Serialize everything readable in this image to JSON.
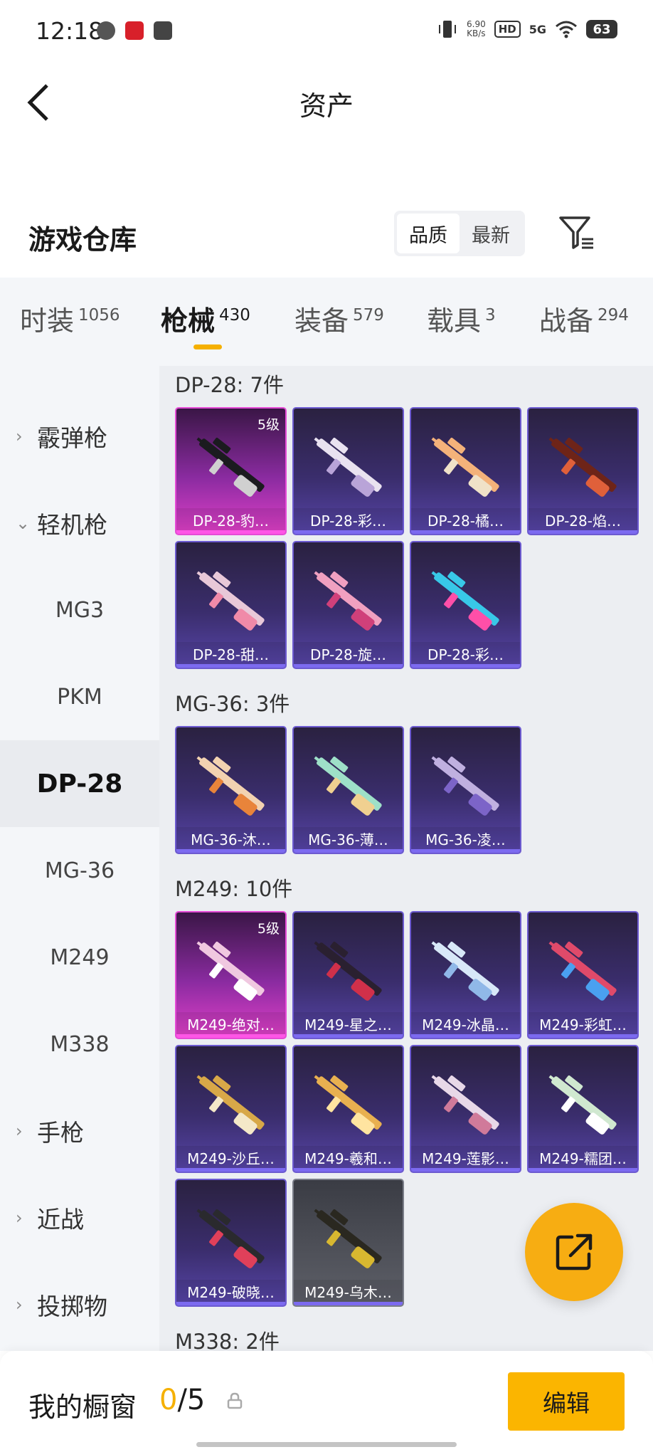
{
  "status_bar": {
    "time": "12:18",
    "net_speed": "6.90",
    "net_unit": "KB/s",
    "hd": "HD",
    "signal": "5G",
    "battery": "63"
  },
  "header": {
    "title": "资产"
  },
  "warehouse": {
    "title": "游戏仓库",
    "sort_options": [
      "品质",
      "最新"
    ]
  },
  "tabs": [
    {
      "label": "时装",
      "count": "1056"
    },
    {
      "label": "枪械",
      "count": "430"
    },
    {
      "label": "装备",
      "count": "579"
    },
    {
      "label": "载具",
      "count": "3"
    },
    {
      "label": "战备",
      "count": "294"
    }
  ],
  "sidebar": {
    "items": [
      {
        "label": "霰弹枪",
        "type": "group",
        "expanded": false
      },
      {
        "label": "轻机枪",
        "type": "group",
        "expanded": true
      },
      {
        "label": "MG3",
        "type": "sub"
      },
      {
        "label": "PKM",
        "type": "sub"
      },
      {
        "label": "DP-28",
        "type": "sub",
        "selected": true
      },
      {
        "label": "MG-36",
        "type": "sub"
      },
      {
        "label": "M249",
        "type": "sub"
      },
      {
        "label": "M338",
        "type": "sub"
      },
      {
        "label": "手枪",
        "type": "group",
        "expanded": false
      },
      {
        "label": "近战",
        "type": "group",
        "expanded": false
      },
      {
        "label": "投掷物",
        "type": "group",
        "expanded": false
      }
    ]
  },
  "sections": [
    {
      "title": "DP-28: 7件",
      "items": [
        {
          "label": "DP-28-豹…",
          "level": "5级",
          "rarity": "pink",
          "gun_color": "#1b1b1f",
          "accent": "#d0d0d0"
        },
        {
          "label": "DP-28-彩…",
          "rarity": "purple",
          "gun_color": "#e9e2f0",
          "accent": "#b9a4d8"
        },
        {
          "label": "DP-28-橘…",
          "rarity": "purple",
          "gun_color": "#f4b27a",
          "accent": "#f0e2c8"
        },
        {
          "label": "DP-28-焰…",
          "rarity": "purple",
          "gun_color": "#6e2418",
          "accent": "#e0603a"
        },
        {
          "label": "DP-28-甜…",
          "rarity": "purple",
          "gun_color": "#e8c8d8",
          "accent": "#f08aa8"
        },
        {
          "label": "DP-28-旋…",
          "rarity": "purple",
          "gun_color": "#f0a0c0",
          "accent": "#d0407a"
        },
        {
          "label": "DP-28-彩…",
          "rarity": "purple",
          "gun_color": "#38c8e8",
          "accent": "#ff4fa8"
        }
      ]
    },
    {
      "title": "MG-36: 3件",
      "items": [
        {
          "label": "MG-36-沐…",
          "rarity": "purple",
          "gun_color": "#f2d2b0",
          "accent": "#e8843a"
        },
        {
          "label": "MG-36-薄…",
          "rarity": "purple",
          "gun_color": "#9ee0c8",
          "accent": "#f0d090"
        },
        {
          "label": "MG-36-凌…",
          "rarity": "purple",
          "gun_color": "#c0b0e0",
          "accent": "#7c64c8"
        }
      ]
    },
    {
      "title": "M249: 10件",
      "items": [
        {
          "label": "M249-绝对…",
          "level": "5级",
          "rarity": "pink",
          "gun_color": "#f0c8e0",
          "accent": "#ffffff"
        },
        {
          "label": "M249-星之…",
          "rarity": "purple",
          "gun_color": "#2a2030",
          "accent": "#d0304a"
        },
        {
          "label": "M249-冰晶…",
          "rarity": "purple",
          "gun_color": "#d8e8f8",
          "accent": "#90b8e8"
        },
        {
          "label": "M249-彩虹…",
          "rarity": "purple",
          "gun_color": "#e04a6a",
          "accent": "#4aa0f0"
        },
        {
          "label": "M249-沙丘…",
          "rarity": "purple",
          "gun_color": "#d8a848",
          "accent": "#f4e8c8"
        },
        {
          "label": "M249-羲和…",
          "rarity": "purple",
          "gun_color": "#e8b050",
          "accent": "#ffe4a0"
        },
        {
          "label": "M249-莲影…",
          "rarity": "purple",
          "gun_color": "#e8d8e8",
          "accent": "#d07a9a"
        },
        {
          "label": "M249-糯团…",
          "rarity": "purple",
          "gun_color": "#d0e8d0",
          "accent": "#ffffff"
        },
        {
          "label": "M249-破晓…",
          "rarity": "purple",
          "gun_color": "#2a2a2e",
          "accent": "#e0405a"
        },
        {
          "label": "M249-乌木…",
          "rarity": "gray",
          "gun_color": "#2a2820",
          "accent": "#d8b830"
        }
      ]
    },
    {
      "title": "M338: 2件",
      "items": []
    }
  ],
  "bottom_bar": {
    "showcase_label": "我的橱窗",
    "showcase_current": "0",
    "showcase_total": "/5",
    "edit_label": "编辑"
  }
}
